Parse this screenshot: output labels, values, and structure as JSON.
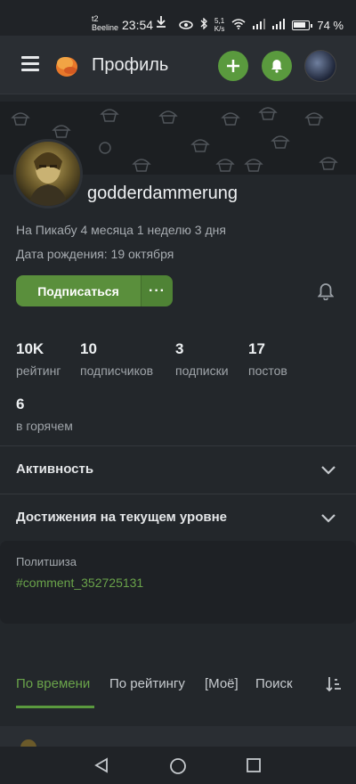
{
  "status_bar": {
    "carrier_line1": "t2",
    "carrier_line2": "Beeline",
    "time": "23:54",
    "speed_value": "5,1",
    "speed_unit": "K/s",
    "battery": "74 %"
  },
  "header": {
    "title": "Профиль",
    "icons": [
      "menu-icon",
      "pikabu-logo",
      "plus-icon",
      "bell-icon",
      "avatar"
    ]
  },
  "profile": {
    "username": "godderdammerung",
    "on_site": "На Пикабу 4 месяца 1 неделю 3 дня",
    "birthday": "Дата рождения: 19 октября",
    "subscribe_label": "Подписаться",
    "more_label": "···"
  },
  "stats": [
    {
      "value": "10K",
      "label": "рейтинг"
    },
    {
      "value": "10",
      "label": "подписчиков"
    },
    {
      "value": "3",
      "label": "подписки"
    },
    {
      "value": "17",
      "label": "постов"
    },
    {
      "value": "6",
      "label": "в горячем"
    }
  ],
  "sections": {
    "activity": "Активность",
    "achievements": "Достижения на текущем уровне"
  },
  "note": {
    "title": "Политшиза",
    "link": "#comment_352725131"
  },
  "tabs": [
    {
      "label": "По времени",
      "active": true
    },
    {
      "label": "По рейтингу",
      "active": false
    },
    {
      "label": "[Моё]",
      "active": false
    },
    {
      "label": "Поиск",
      "active": false
    }
  ],
  "colors": {
    "accent": "#5a9a3e",
    "link": "#6aa34a",
    "background": "#23272b"
  }
}
